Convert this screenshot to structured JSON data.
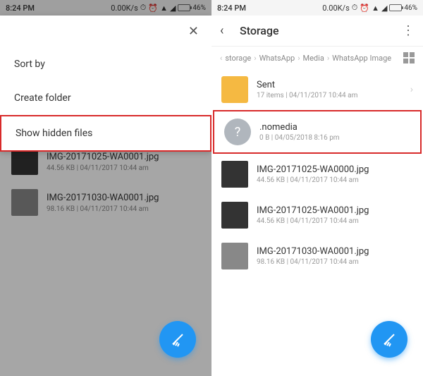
{
  "status": {
    "time": "8:24 PM",
    "speed": "0.00K/s",
    "battery": "46%"
  },
  "left": {
    "menu": {
      "sort": "Sort by",
      "create": "Create folder",
      "show_hidden": "Show hidden files"
    },
    "files": [
      {
        "name": "IMG-20171025-WA0001.jpg",
        "meta": "44.56 KB | 04/11/2017 10:44 am"
      },
      {
        "name": "IMG-20171030-WA0001.jpg",
        "meta": "98.16 KB | 04/11/2017 10:44 am"
      }
    ]
  },
  "right": {
    "title": "Storage",
    "breadcrumb": [
      "storage",
      "WhatsApp",
      "Media",
      "WhatsApp Image"
    ],
    "items": [
      {
        "name": "Sent",
        "meta": "17 items | 04/11/2017 10:44 am",
        "type": "folder"
      },
      {
        "name": ".nomedia",
        "meta": "0 B | 04/05/2018 8:16 pm",
        "type": "unknown"
      },
      {
        "name": "IMG-20171025-WA0000.jpg",
        "meta": "44.56 KB | 04/11/2017 10:44 am",
        "type": "image-dark"
      },
      {
        "name": "IMG-20171025-WA0001.jpg",
        "meta": "44.56 KB | 04/11/2017 10:44 am",
        "type": "image-dark"
      },
      {
        "name": "IMG-20171030-WA0001.jpg",
        "meta": "98.16 KB | 04/11/2017 10:44 am",
        "type": "image-gray"
      }
    ]
  }
}
